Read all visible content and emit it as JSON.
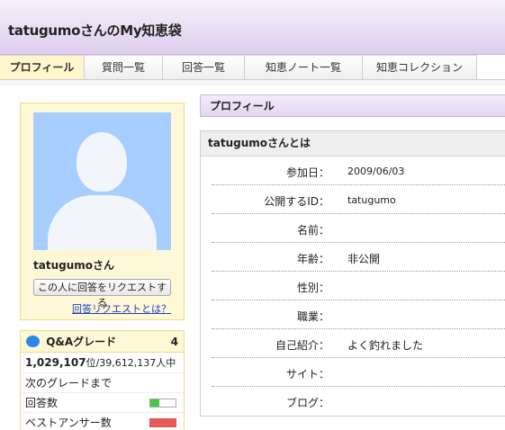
{
  "header": {
    "title": "tatugumoさんのMy知恵袋"
  },
  "tabs": [
    {
      "label": "プロフィール",
      "active": true
    },
    {
      "label": "質問一覧"
    },
    {
      "label": "回答一覧"
    },
    {
      "label": "知恵ノート一覧"
    },
    {
      "label": "知恵コレクション"
    }
  ],
  "sidebar": {
    "user_name": "tatugumoさん",
    "request_button": "この人に回答をリクエストする",
    "request_help_link": "回答リクエストとは？",
    "grade": {
      "title": "Q&Aグレード",
      "level": "4",
      "rank": "1,029,107",
      "rank_suffix": "位/39,612,137人中",
      "next_grade_label": "次のグレードまで",
      "answers_label": "回答数",
      "answers_progress": 0.35,
      "best_answers_label": "ベストアンサー数",
      "best_answers_progress": 1.0,
      "colors": {
        "answers": "#4ac43e",
        "best_answers": "#ea5a5a"
      }
    }
  },
  "main": {
    "section_title": "プロフィール",
    "panel_title": "tatugumoさんとは",
    "fields": [
      {
        "label": "参加日：",
        "value": "2009/06/03"
      },
      {
        "label": "公開するID：",
        "value": "tatugumo"
      },
      {
        "label": "名前：",
        "value": ""
      },
      {
        "label": "年齢：",
        "value": "非公開"
      },
      {
        "label": "性別：",
        "value": ""
      },
      {
        "label": "職業：",
        "value": ""
      },
      {
        "label": "自己紹介：",
        "value": "よく釣れました"
      },
      {
        "label": "サイト：",
        "value": ""
      },
      {
        "label": "ブログ：",
        "value": ""
      }
    ]
  }
}
